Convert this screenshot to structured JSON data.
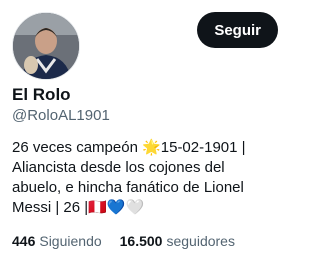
{
  "profile": {
    "display_name": "El Rolo",
    "handle": "@RoloAL1901",
    "follow_button": "Seguir",
    "bio": "26 veces campeón 🌟15-02-1901 |\nAliancista desde los cojones del\nabuelo, e hincha fanático de Lionel\nMessi | 26 |🇵🇪💙🤍"
  },
  "stats": {
    "following_count": "446",
    "following_label": "Siguiendo",
    "followers_count": "16.500",
    "followers_label": "seguidores"
  },
  "colors": {
    "button_bg": "#0f1419",
    "muted_text": "#536471"
  }
}
